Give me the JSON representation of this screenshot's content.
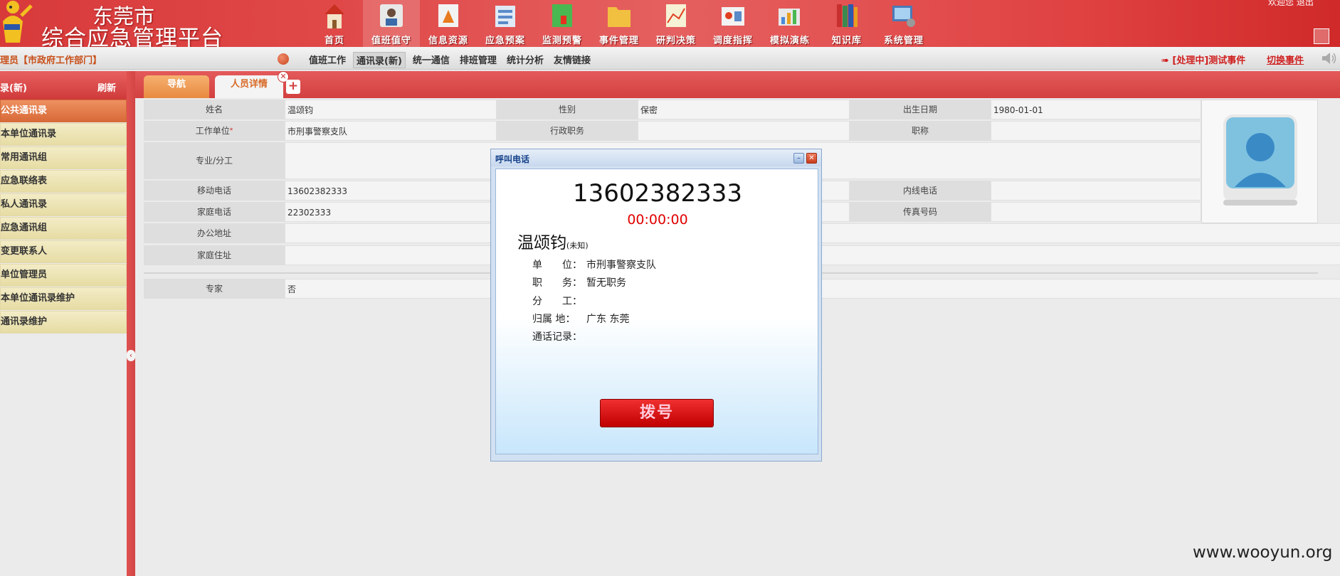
{
  "header": {
    "title_line1": "东莞市",
    "title_line2": "综合应急管理平台",
    "user_corner": "欢迎您 退出",
    "nav": [
      {
        "label": "首页",
        "icon": "home-icon"
      },
      {
        "label": "值班值守",
        "icon": "duty-icon"
      },
      {
        "label": "信息资源",
        "icon": "info-resource-icon"
      },
      {
        "label": "应急预案",
        "icon": "emergency-plan-icon"
      },
      {
        "label": "监测预警",
        "icon": "monitor-icon"
      },
      {
        "label": "事件管理",
        "icon": "folder-icon"
      },
      {
        "label": "研判决策",
        "icon": "analysis-icon"
      },
      {
        "label": "调度指挥",
        "icon": "dispatch-icon"
      },
      {
        "label": "模拟演练",
        "icon": "simulation-icon"
      },
      {
        "label": "知识库",
        "icon": "books-icon"
      },
      {
        "label": "系统管理",
        "icon": "system-icon"
      }
    ]
  },
  "subnav": {
    "user": "理员【市政府工作部门】",
    "menu": [
      "值班工作",
      "通讯录(新)",
      "统一通信",
      "排班管理",
      "统计分析",
      "友情链接"
    ],
    "event": "[处理中]测试事件",
    "switch": "切换事件"
  },
  "sidebar": {
    "title": "录(新)",
    "refresh": "刷新",
    "items": [
      "公共通讯录",
      "本单位通讯录",
      "常用通讯组",
      "应急联络表",
      "私人通讯录",
      "应急通讯组",
      "变更联系人",
      "单位管理员",
      "本单位通讯录维护",
      "通讯录维护"
    ]
  },
  "tabs": {
    "nav": "导航",
    "detail": "人员详情"
  },
  "person": {
    "name_label": "姓名",
    "name": "温颂钧",
    "gender_label": "性别",
    "gender": "保密",
    "birth_label": "出生日期",
    "birth": "1980-01-01",
    "unit_label": "工作单位",
    "unit": "市刑事警察支队",
    "admin_label": "行政职务",
    "admin": "",
    "title_label": "职称",
    "title": "",
    "spec_label": "专业/分工",
    "spec": "",
    "mobile_label": "移动电话",
    "mobile": "13602382333",
    "ext_label": "内线电话",
    "ext": "",
    "home_label": "家庭电话",
    "home": "22302333",
    "fax_label": "传真号码",
    "fax": "",
    "office_label": "办公地址",
    "office": "",
    "addr_label": "家庭住址",
    "addr": "",
    "expert_label": "专家",
    "expert": "否"
  },
  "dialog": {
    "title": "呼叫电话",
    "phone": "13602382333",
    "timer": "00:00:00",
    "name": "温颂钧",
    "name_suffix": "(未知)",
    "rows": [
      {
        "k": "单　　位：",
        "v": "市刑事警察支队"
      },
      {
        "k": "职　　务：",
        "v": "暂无职务"
      },
      {
        "k": "分　　工：",
        "v": ""
      },
      {
        "k": "  归属 地：",
        "v": "广东 东莞"
      },
      {
        "k": "通话记录：",
        "v": ""
      }
    ],
    "dial": "拨号"
  },
  "watermark": "www.wooyun.org"
}
